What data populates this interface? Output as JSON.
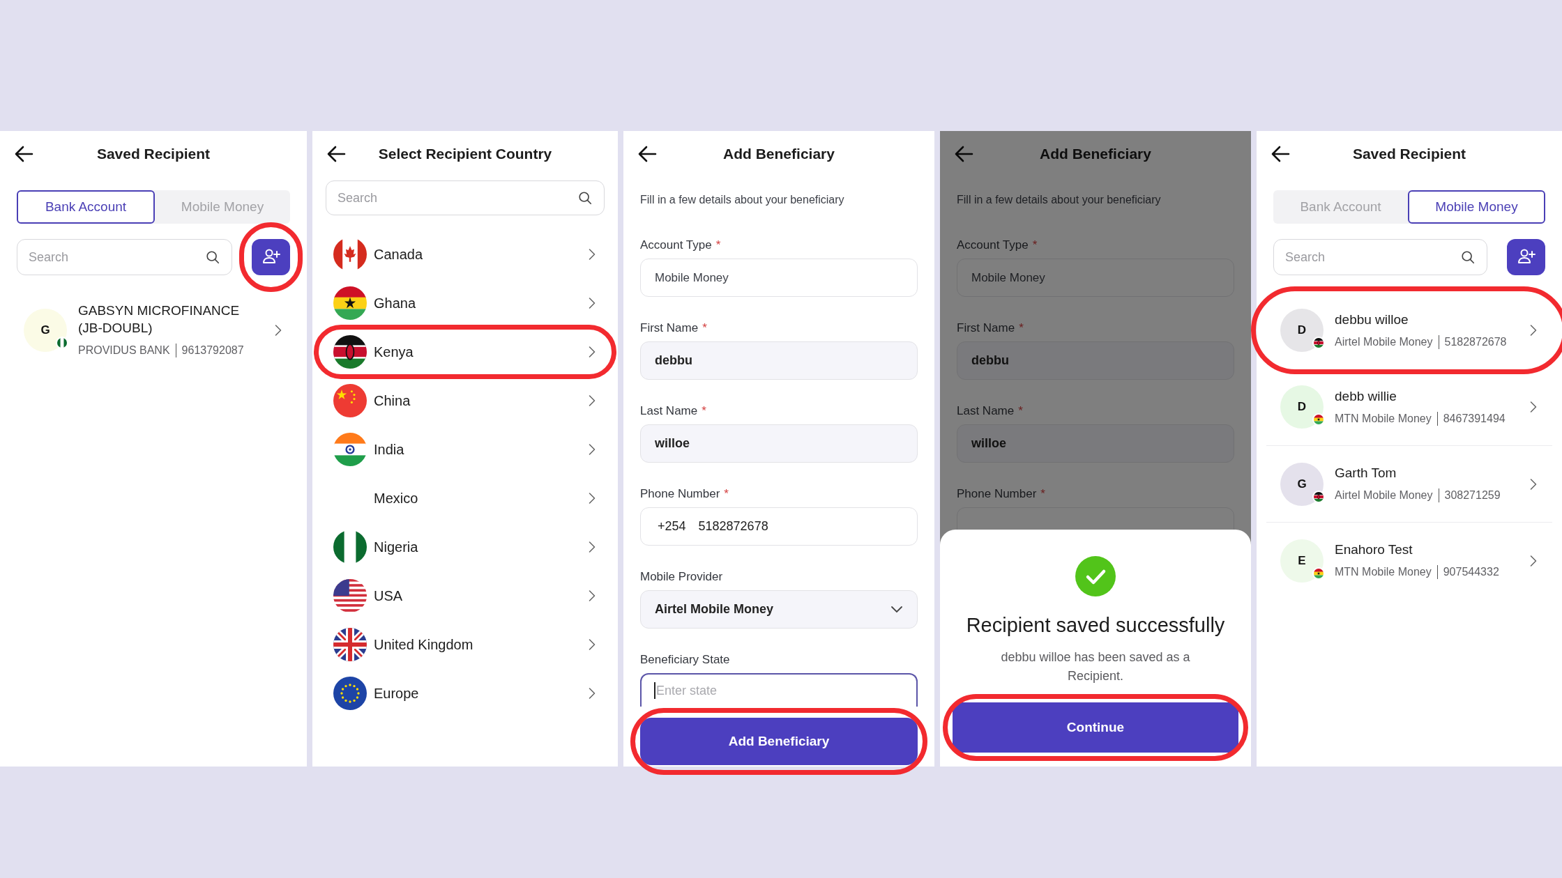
{
  "saved_recipients_before": {
    "title": "Saved Recipient",
    "tabs": [
      {
        "label": "Bank Account",
        "selected": true
      },
      {
        "label": "Mobile Money",
        "selected": false
      }
    ],
    "search": {
      "placeholder": "Search"
    },
    "add_button": {
      "highlighted": true
    },
    "recipients": [
      {
        "initial": "G",
        "color": "#fbfbe6",
        "kind": "ng",
        "name": "GABSYN MICROFINANCE (JB-DOUBL)",
        "provider": "PROVIDUS BANK",
        "number": "9613792087",
        "highlighted": false
      }
    ]
  },
  "country_select": {
    "title": "Select Recipient Country",
    "search": {
      "placeholder": "Search"
    },
    "countries": [
      {
        "name": "Canada",
        "kind": "ca",
        "highlighted": false
      },
      {
        "name": "Ghana",
        "kind": "gh",
        "highlighted": false
      },
      {
        "name": "Kenya",
        "kind": "ke",
        "highlighted": true
      },
      {
        "name": "China",
        "kind": "cn",
        "highlighted": false
      },
      {
        "name": "India",
        "kind": "in",
        "highlighted": false
      },
      {
        "name": "Mexico",
        "kind": "none",
        "highlighted": false
      },
      {
        "name": "Nigeria",
        "kind": "ng",
        "highlighted": false
      },
      {
        "name": "USA",
        "kind": "us",
        "highlighted": false
      },
      {
        "name": "United Kingdom",
        "kind": "gb",
        "highlighted": false
      },
      {
        "name": "Europe",
        "kind": "eu",
        "highlighted": false
      }
    ]
  },
  "add_beneficiary": {
    "title": "Add Beneficiary",
    "subtitle": "Fill in a few details about your beneficiary",
    "fields": [
      {
        "kind": "readonly",
        "label": "Account Type",
        "marker": "*",
        "value": "Mobile Money"
      },
      {
        "kind": "text",
        "label": "First Name",
        "marker": "*",
        "value": "debbu"
      },
      {
        "kind": "text",
        "label": "Last Name",
        "marker": "*",
        "value": "willoe"
      },
      {
        "kind": "phone",
        "label": "Phone Number",
        "marker": "*",
        "prefix": "+254",
        "value": "5182872678"
      },
      {
        "kind": "select",
        "label": "Mobile Provider",
        "value": "Airtel Mobile Money"
      },
      {
        "kind": "input",
        "label": "Beneficiary State",
        "placeholder": "Enter state"
      }
    ],
    "button": {
      "label": "Add Beneficiary",
      "highlighted": true
    }
  },
  "success_screen": {
    "title": "Add Beneficiary",
    "subtitle": "Fill in a few details about your beneficiary",
    "fields": [
      {
        "kind": "readonly",
        "label": "Account Type",
        "marker": "*",
        "value": "Mobile Money"
      },
      {
        "kind": "text",
        "label": "First Name",
        "marker": "*",
        "value": "debbu"
      },
      {
        "kind": "text",
        "label": "Last Name",
        "marker": "*",
        "value": "willoe"
      },
      {
        "kind": "hidden",
        "label": "Phone Number",
        "marker": "*"
      }
    ],
    "sheet": {
      "heading": "Recipient saved successfully",
      "message": "debbu willoe has been saved as a Recipient.",
      "button": {
        "label": "Continue",
        "highlighted": true
      }
    }
  },
  "saved_recipients_after": {
    "title": "Saved Recipient",
    "tabs": [
      {
        "label": "Bank Account",
        "selected": false
      },
      {
        "label": "Mobile Money",
        "selected": true
      }
    ],
    "search": {
      "placeholder": "Search"
    },
    "add_button": {
      "highlighted": false
    },
    "recipients": [
      {
        "initial": "D",
        "color": "#e6e5e8",
        "kind": "ke",
        "name": "debbu willoe",
        "provider": "Airtel Mobile Money",
        "number": "5182872678",
        "highlighted": true
      },
      {
        "initial": "D",
        "color": "#e6f8e4",
        "kind": "gh",
        "name": "debb willie",
        "provider": "MTN Mobile Money",
        "number": "8467391494",
        "highlighted": false
      },
      {
        "initial": "G",
        "color": "#e4e1ec",
        "kind": "ke",
        "name": "Garth Tom",
        "provider": "Airtel Mobile Money",
        "number": "308271259",
        "highlighted": false
      },
      {
        "initial": "E",
        "color": "#eef9ea",
        "kind": "gh",
        "name": "Enahoro  Test",
        "provider": "MTN Mobile Money",
        "number": "907544332",
        "highlighted": false
      }
    ]
  }
}
